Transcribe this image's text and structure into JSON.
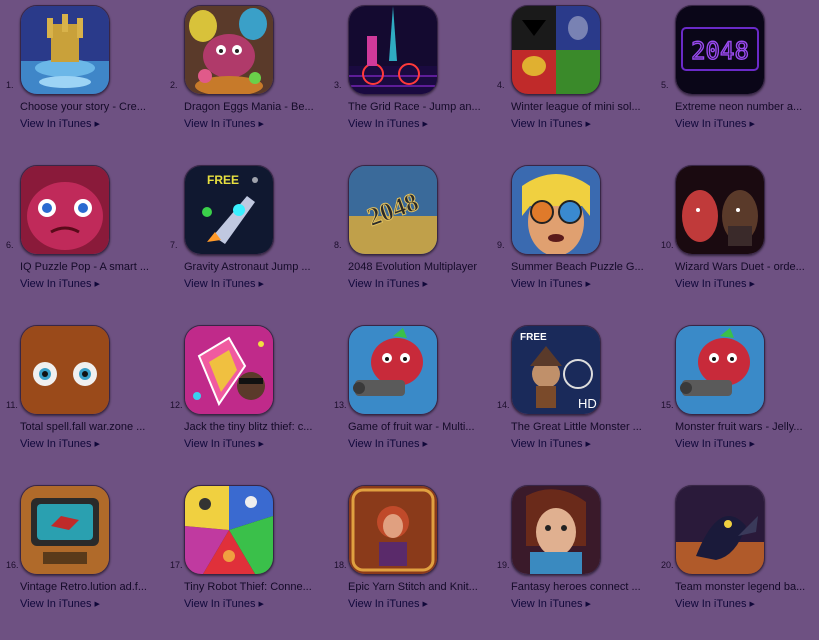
{
  "view_link_label": "View In iTunes",
  "view_link_arrow": "▶",
  "apps": [
    {
      "rank": "1.",
      "title": "Choose your story - Cre...",
      "icon": "castle-icon"
    },
    {
      "rank": "2.",
      "title": "Dragon Eggs Mania - Be...",
      "icon": "dragon-eggs-icon"
    },
    {
      "rank": "3.",
      "title": "The Grid Race - Jump an...",
      "icon": "neon-biker-icon"
    },
    {
      "rank": "4.",
      "title": "Winter league of mini sol...",
      "icon": "superhero-masks-icon"
    },
    {
      "rank": "5.",
      "title": "Extreme neon number a...",
      "icon": "neon-2048-icon"
    },
    {
      "rank": "6.",
      "title": "IQ Puzzle Pop - A smart ...",
      "icon": "pink-monster-icon"
    },
    {
      "rank": "7.",
      "title": "Gravity Astronaut Jump ...",
      "icon": "rocket-icon"
    },
    {
      "rank": "8.",
      "title": "2048 Evolution Multiplayer",
      "icon": "2048-evolution-icon"
    },
    {
      "rank": "9.",
      "title": "Summer Beach Puzzle G...",
      "icon": "sunglasses-girl-icon"
    },
    {
      "rank": "10.",
      "title": "Wizard Wars Duet - orde...",
      "icon": "wizard-faces-icon"
    },
    {
      "rank": "11.",
      "title": "Total spell.fall war.zone ...",
      "icon": "orange-eyes-icon"
    },
    {
      "rank": "12.",
      "title": "Jack the tiny blitz thief: c...",
      "icon": "gem-thief-icon"
    },
    {
      "rank": "13.",
      "title": "Game of fruit war - Multi...",
      "icon": "fruit-gunner-icon"
    },
    {
      "rank": "14.",
      "title": "The Great Little Monster ...",
      "icon": "scarecrow-icon"
    },
    {
      "rank": "15.",
      "title": "Monster fruit wars - Jelly...",
      "icon": "fruit-gunner-icon"
    },
    {
      "rank": "16.",
      "title": "Vintage Retro.lution ad.f...",
      "icon": "retro-tv-icon"
    },
    {
      "rank": "17.",
      "title": "Tiny Robot Thief: Conne...",
      "icon": "robot-wheel-icon"
    },
    {
      "rank": "18.",
      "title": "Epic Yarn Stitch and Knit...",
      "icon": "yarn-girl-icon"
    },
    {
      "rank": "19.",
      "title": "Fantasy heroes connect ...",
      "icon": "fantasy-hero-icon"
    },
    {
      "rank": "20.",
      "title": "Team monster legend ba...",
      "icon": "monster-legend-icon"
    }
  ],
  "icon_badges": {
    "rocket-icon": "FREE",
    "neon-2048-icon": "2048",
    "2048-evolution-icon": "2048",
    "scarecrow-icon": "FREE",
    "scarecrow-hd": "HD"
  }
}
